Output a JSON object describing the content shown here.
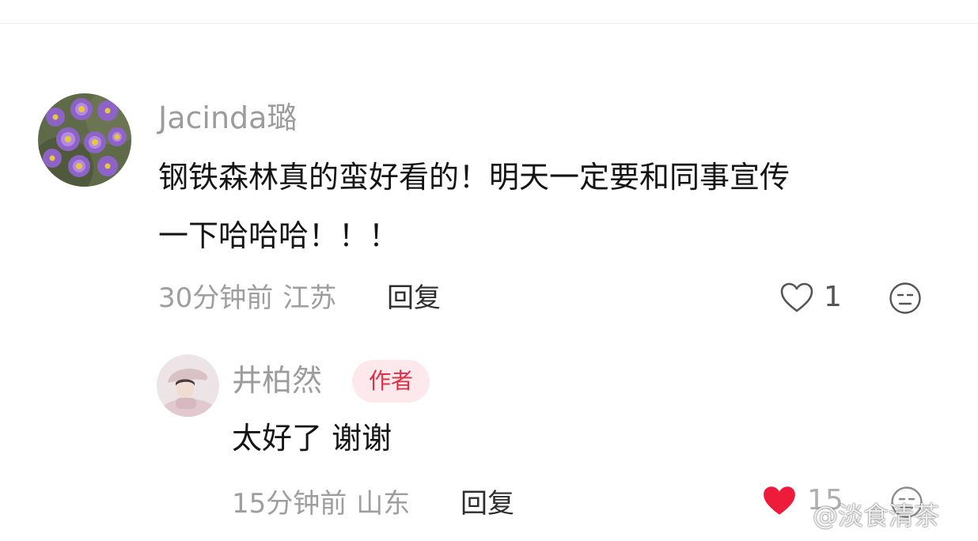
{
  "comment": {
    "username": "Jacinda璐",
    "text_line1": "钢铁森林真的蛮好看的！明天一定要和同事宣传",
    "text_line2": "一下哈哈哈！！！",
    "time": "30分钟前",
    "location": "江苏",
    "reply_label": "回复",
    "like_count": "1",
    "liked": false,
    "avatar_icon": "purple-flowers-avatar"
  },
  "reply": {
    "username": "井柏然",
    "badge": "作者",
    "text": "太好了 谢谢",
    "time": "15分钟前",
    "location": "山东",
    "reply_label": "回复",
    "like_count": "15",
    "liked": true,
    "avatar_icon": "person-in-hat-avatar"
  },
  "watermark": "@淡食清茶",
  "colors": {
    "username": "#9c9c9c",
    "badge_bg": "#fde9ec",
    "badge_text": "#e02e45",
    "liked_heart": "#ee1c3a",
    "meta": "#9e9e9e"
  }
}
